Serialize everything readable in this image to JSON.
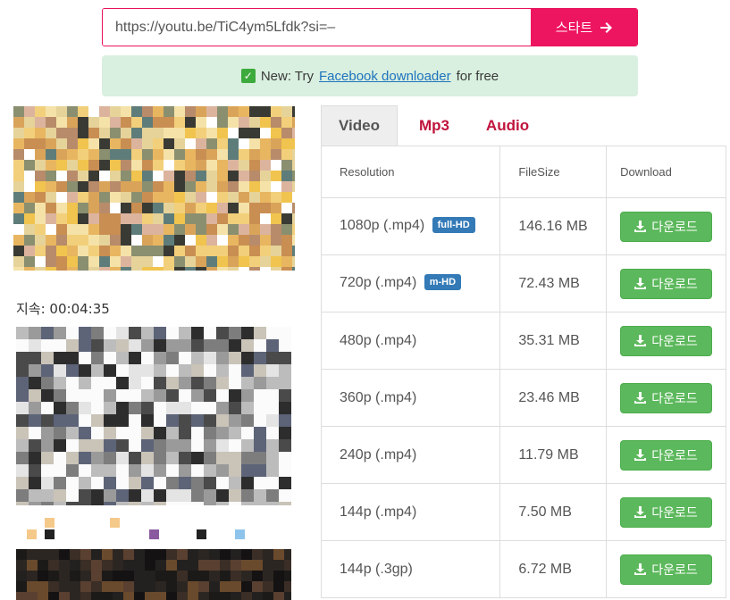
{
  "search": {
    "url_value": "https://youtu.be/TiC4ym5Lfdk?si=–",
    "start_label": "스타트"
  },
  "notice": {
    "prefix": "New: Try ",
    "link": "Facebook downloader",
    "suffix": " for free"
  },
  "video": {
    "duration": "지속: 00:04:35"
  },
  "tabs": [
    {
      "label": "Video"
    },
    {
      "label": "Mp3"
    },
    {
      "label": "Audio"
    }
  ],
  "table": {
    "headers": [
      "Resolution",
      "FileSize",
      "Download"
    ],
    "rows": [
      {
        "resolution": "1080p (.mp4)",
        "badge": "full-HD",
        "size": "146.16 MB",
        "button": "다운로드"
      },
      {
        "resolution": "720p (.mp4)",
        "badge": "m-HD",
        "size": "72.43 MB",
        "button": "다운로드"
      },
      {
        "resolution": "480p (.mp4)",
        "badge": "",
        "size": "35.31 MB",
        "button": "다운로드"
      },
      {
        "resolution": "360p (.mp4)",
        "badge": "",
        "size": "23.46 MB",
        "button": "다운로드"
      },
      {
        "resolution": "240p (.mp4)",
        "badge": "",
        "size": "11.79 MB",
        "button": "다운로드"
      },
      {
        "resolution": "144p (.mp4)",
        "badge": "",
        "size": "7.50 MB",
        "button": "다운로드"
      },
      {
        "resolution": "144p (.3gp)",
        "badge": "",
        "size": "6.72 MB",
        "button": "다운로드"
      }
    ]
  },
  "colors": {
    "accent": "#ee1560",
    "download": "#5cb85c",
    "badge": "#337ab7",
    "tab_text": "#c0143c",
    "notice_bg": "#d9efdf"
  },
  "icons": [
    "arrow-right-icon",
    "check-icon",
    "download-icon"
  ]
}
